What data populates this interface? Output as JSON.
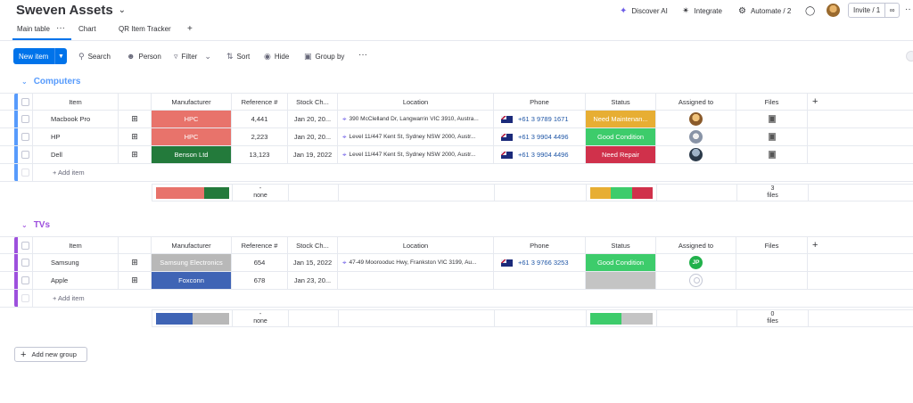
{
  "header": {
    "board_title": "Sweven Assets",
    "discover_ai": "Discover AI",
    "integrate": "Integrate",
    "automate": "Automate / 2",
    "invite": "Invite / 1"
  },
  "tabs": [
    {
      "label": "Main table"
    },
    {
      "label": "Chart"
    },
    {
      "label": "QR Item Tracker"
    }
  ],
  "toolbar": {
    "new_item": "New item",
    "search": "Search",
    "person": "Person",
    "filter": "Filter",
    "sort": "Sort",
    "hide": "Hide",
    "group_by": "Group by"
  },
  "columns": {
    "item": "Item",
    "manufacturer": "Manufacturer",
    "reference": "Reference #",
    "stock": "Stock Ch...",
    "location": "Location",
    "phone": "Phone",
    "status": "Status",
    "assigned": "Assigned to",
    "files": "Files"
  },
  "add_item_label": "+ Add item",
  "add_group_label": "Add new group",
  "colors": {
    "computers": "#579bfc",
    "tvs": "#9d50dd",
    "hpc": "#e8736b",
    "benson": "#237a3b",
    "samsung": "#b8b8b8",
    "foxconn": "#3f64b5",
    "need_maintenance": "#e7ae33",
    "good_condition": "#3dcc6b",
    "need_repair": "#d0314b",
    "empty_status": "#c4c4c4"
  },
  "groups": [
    {
      "title": "Computers",
      "rows": [
        {
          "item": "Macbook Pro",
          "manufacturer": "HPC",
          "reference": "4,441",
          "stock": "Jan 20, 20...",
          "location": "390 McClelland Dr, Langwarrin VIC 3910, Austra...",
          "phone": "+61 3 9789 1671",
          "status": "Need Maintenan...",
          "avatar": "photo-a"
        },
        {
          "item": "HP",
          "manufacturer": "HPC",
          "reference": "2,223",
          "stock": "Jan 20, 20...",
          "location": "Level 11/447 Kent St, Sydney NSW 2000, Austr...",
          "phone": "+61 3 9904 4496",
          "status": "Good Condition",
          "avatar": "photo-b"
        },
        {
          "item": "Dell",
          "manufacturer": "Benson Ltd",
          "reference": "13,123",
          "stock": "Jan 19, 2022",
          "location": "Level 11/447 Kent St, Sydney NSW 2000, Austr...",
          "phone": "+61 3 9904 4496",
          "status": "Need Repair",
          "avatar": "photo-c"
        }
      ],
      "summary": {
        "reference_value": "-",
        "reference_label": "none",
        "files_count": "3",
        "files_label": "files"
      }
    },
    {
      "title": "TVs",
      "rows": [
        {
          "item": "Samsung",
          "manufacturer": "Samsung Electronics",
          "reference": "654",
          "stock": "Jan 15, 2022",
          "location": "47-49 Moorooduc Hwy, Frankston VIC 3199, Au...",
          "phone": "+61 3 9766 3253",
          "status": "Good Condition",
          "avatar": "JP"
        },
        {
          "item": "Apple",
          "manufacturer": "Foxconn",
          "reference": "678",
          "stock": "Jan 23, 20...",
          "location": "",
          "phone": "",
          "status": "",
          "avatar": ""
        }
      ],
      "summary": {
        "reference_value": "-",
        "reference_label": "none",
        "files_count": "0",
        "files_label": "files"
      }
    }
  ]
}
